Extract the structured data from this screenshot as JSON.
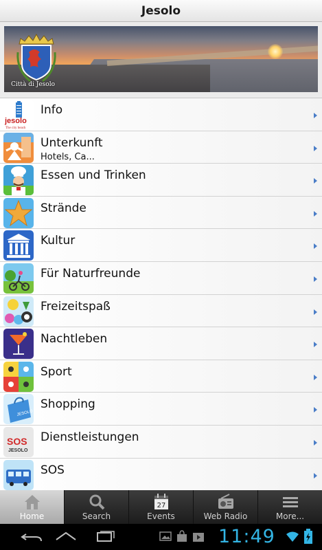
{
  "app": {
    "title": "Jesolo"
  },
  "banner": {
    "crest_caption": "Città di Jesolo"
  },
  "menu": [
    {
      "label": "Info",
      "sublabel": "",
      "icon": "jesolo-logo-icon"
    },
    {
      "label": "Unterkunft",
      "sublabel": "Hotels, Ca...",
      "icon": "accommodation-icon"
    },
    {
      "label": "Essen und Trinken",
      "sublabel": "",
      "icon": "chef-icon"
    },
    {
      "label": "Strände",
      "sublabel": "",
      "icon": "starfish-icon"
    },
    {
      "label": "Kultur",
      "sublabel": "",
      "icon": "temple-icon"
    },
    {
      "label": "Für Naturfreunde",
      "sublabel": "",
      "icon": "nature-cyclist-icon"
    },
    {
      "label": "Freizeitspaß",
      "sublabel": "",
      "icon": "leisure-icon"
    },
    {
      "label": "Nachtleben",
      "sublabel": "",
      "icon": "cocktail-icon"
    },
    {
      "label": "Sport",
      "sublabel": "",
      "icon": "sports-icon"
    },
    {
      "label": "Shopping",
      "sublabel": "",
      "icon": "shopping-bag-icon"
    },
    {
      "label": "Dienstleistungen",
      "sublabel": "",
      "icon": "sos-services-icon"
    },
    {
      "label": "SOS",
      "sublabel": "",
      "icon": "bus-icon"
    }
  ],
  "tabs": [
    {
      "label": "Home",
      "icon": "home-icon",
      "active": true
    },
    {
      "label": "Search",
      "icon": "search-icon",
      "active": false
    },
    {
      "label": "Events",
      "icon": "calendar-icon",
      "active": false,
      "calendar_day": "27"
    },
    {
      "label": "Web Radio",
      "icon": "radio-icon",
      "active": false
    },
    {
      "label": "More...",
      "icon": "more-icon",
      "active": false
    }
  ],
  "system": {
    "time": "11:49"
  },
  "colors": {
    "accent": "#33b5e5",
    "chevron": "#4a7dc7"
  }
}
